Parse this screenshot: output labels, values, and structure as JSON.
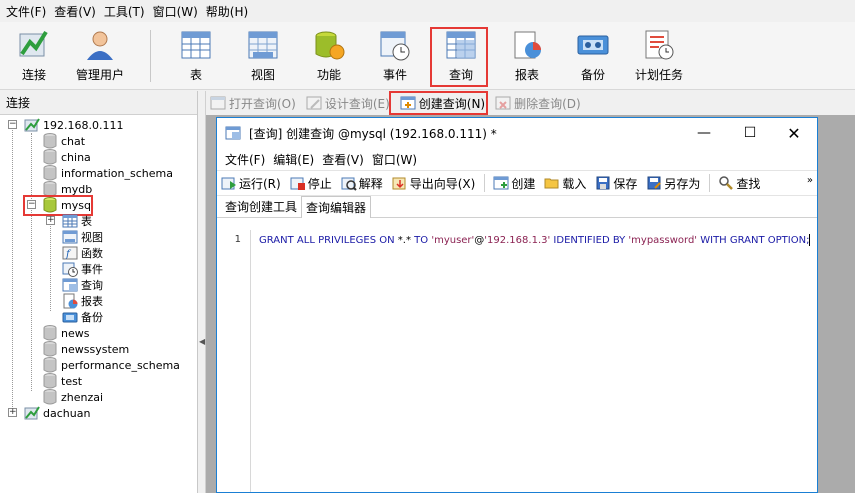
{
  "menubar": {
    "items": [
      "文件(F)",
      "查看(V)",
      "工具(T)",
      "窗口(W)",
      "帮助(H)"
    ]
  },
  "toolbar": {
    "connect": "连接",
    "manage_users": "管理用户",
    "table": "表",
    "view": "视图",
    "function": "功能",
    "event": "事件",
    "query": "查询",
    "report": "报表",
    "backup": "备份",
    "schedule": "计划任务"
  },
  "left_pane": {
    "title": "连接",
    "connections": [
      {
        "name": "192.168.0.111",
        "databases": [
          "chat",
          "china",
          "information_schema",
          "mydb",
          "mysql",
          "news",
          "newssystem",
          "performance_schema",
          "test",
          "zhenzai"
        ],
        "mysql_children": [
          "表",
          "视图",
          "函数",
          "事件",
          "查询",
          "报表",
          "备份"
        ]
      },
      {
        "name": "dachuan"
      }
    ]
  },
  "sub_toolbar": {
    "open": "打开查询(O)",
    "design": "设计查询(E)",
    "create": "创建查询(N)",
    "delete": "删除查询(D)"
  },
  "query_window": {
    "title": "[查询] 创建查询 @mysql (192.168.0.111) *",
    "menu": [
      "文件(F)",
      "编辑(E)",
      "查看(V)",
      "窗口(W)"
    ],
    "tools": {
      "run": "运行(R)",
      "stop": "停止",
      "explain": "解释",
      "export": "导出向导(X)",
      "create": "创建",
      "load": "载入",
      "save": "保存",
      "save_as": "另存为",
      "find": "查找"
    },
    "tabs": [
      "查询创建工具",
      "查询编辑器"
    ],
    "line_number": "1",
    "sql": {
      "part1": "GRANT ALL PRIVILEGES ON ",
      "part2": "*.* ",
      "part3": "TO ",
      "part4": "'myuser'",
      "part5": "@",
      "part6": "'192.168.1.3'",
      "part7": " IDENTIFIED BY ",
      "part8": "'mypassword'",
      "part9": " WITH GRANT OPTION;"
    }
  },
  "colors": {
    "highlight_red": "#e53935",
    "window_border": "#1a7fd4",
    "sql_keyword": "#1a1aa6",
    "sql_string": "#8b2252"
  }
}
